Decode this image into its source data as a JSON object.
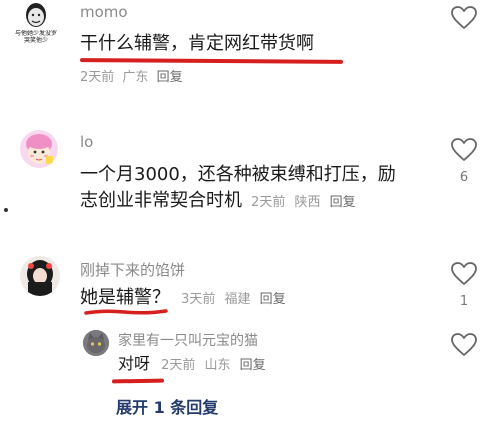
{
  "comments": [
    {
      "username": "momo",
      "text": "干什么辅警，肯定网红带货啊",
      "time": "2天前",
      "location": "广东",
      "reply_label": "回复",
      "likes": ""
    },
    {
      "username": "lo",
      "text_line1": "一个月3000，还各种被束缚和打压，励",
      "text_line2": "志创业非常契合时机",
      "time": "2天前",
      "location": "陕西",
      "reply_label": "回复",
      "likes": "6"
    },
    {
      "username": "刚掉下来的馅饼",
      "text": "她是辅警？",
      "time": "3天前",
      "location": "福建",
      "reply_label": "回复",
      "likes": "1"
    }
  ],
  "reply": {
    "username": "家里有一只叫元宝的猫",
    "text": "对呀",
    "time": "2天前",
    "location": "山东",
    "reply_label": "回复",
    "likes": ""
  },
  "expand_label": "展开 1 条回复",
  "meme_avatar_caption": "与他她少发没罗哭笑他少",
  "colors": {
    "underline": "#d61f1f",
    "expand_link": "#243b6b",
    "meta": "#9a9a9a"
  }
}
